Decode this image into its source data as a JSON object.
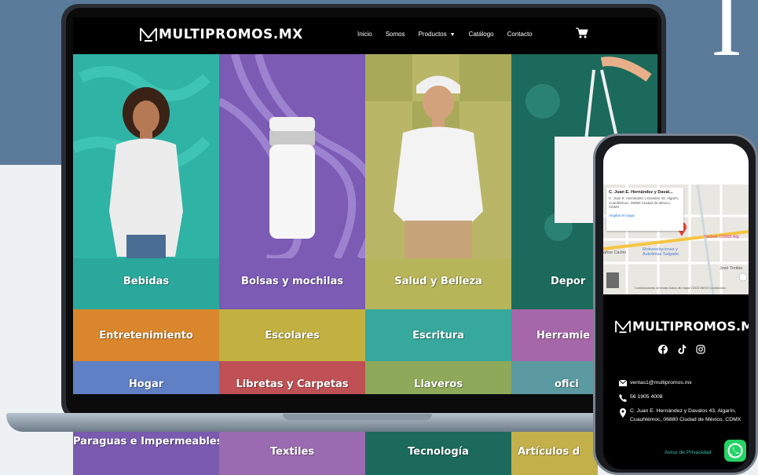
{
  "site": {
    "brand_part1": "M",
    "brand_part2": "MULTIPROMOS.MX",
    "nav": [
      "Inicio",
      "Somos",
      "Productos",
      "Catálogo",
      "Contacto"
    ],
    "cart_icon": "cart-icon"
  },
  "categories": {
    "hero": [
      "Bebidas",
      "Bolsas y mochilas",
      "Salud y Belleza",
      "Depor"
    ],
    "row2": [
      "Entretenimiento",
      "Escolares",
      "Escritura",
      "Herramie"
    ],
    "row3": [
      "Hogar",
      "Libretas y Carpetas",
      "Llaveros",
      "ofici"
    ],
    "row4": [
      "Paraguas e Impermeables",
      "Textiles",
      "Tecnología",
      "Artículos d"
    ]
  },
  "phone": {
    "map_card": {
      "title": "C. Juan E. Hernández y Daval...",
      "address": "C. Juan E. Hernández y Davalos 43, Algarín, Cuauhtémoc, 06880 Ciudad de México, CDMX",
      "link": "Ampliar el mapa"
    },
    "map_labels": {
      "label1": "Yazbek CDMX Alg",
      "label2": "Motivenilaciones y Autotintas Salgado",
      "label3": "José Toribio",
      "label4": "años Cacho",
      "footer": "Combinaciones de teclas   Datos del mapa ©2025 INEGI   Condiciones"
    },
    "brand": "MULTIPROMOS.MX",
    "email": "ventas1@multipromos.mx",
    "phone": "56 1905 4008",
    "address": "C. Juan E. Hernández y Davalos 43, Algarín, Cuauhtémoc, 06880 Ciudad de México, CDMX",
    "privacy": "Aviso de Privacidad"
  },
  "colors": {
    "teal": "#2aa89b",
    "purple": "#7b5bb4",
    "olive": "#b6b55a",
    "dark_green": "#1b6a5c",
    "orange": "#d9862c",
    "mustard": "#c2b141",
    "sea": "#36a89c",
    "mauve": "#a667a8",
    "blue": "#5f80c4",
    "red": "#bf5054",
    "green": "#8fa95a",
    "aqua": "#5a9aa0"
  }
}
